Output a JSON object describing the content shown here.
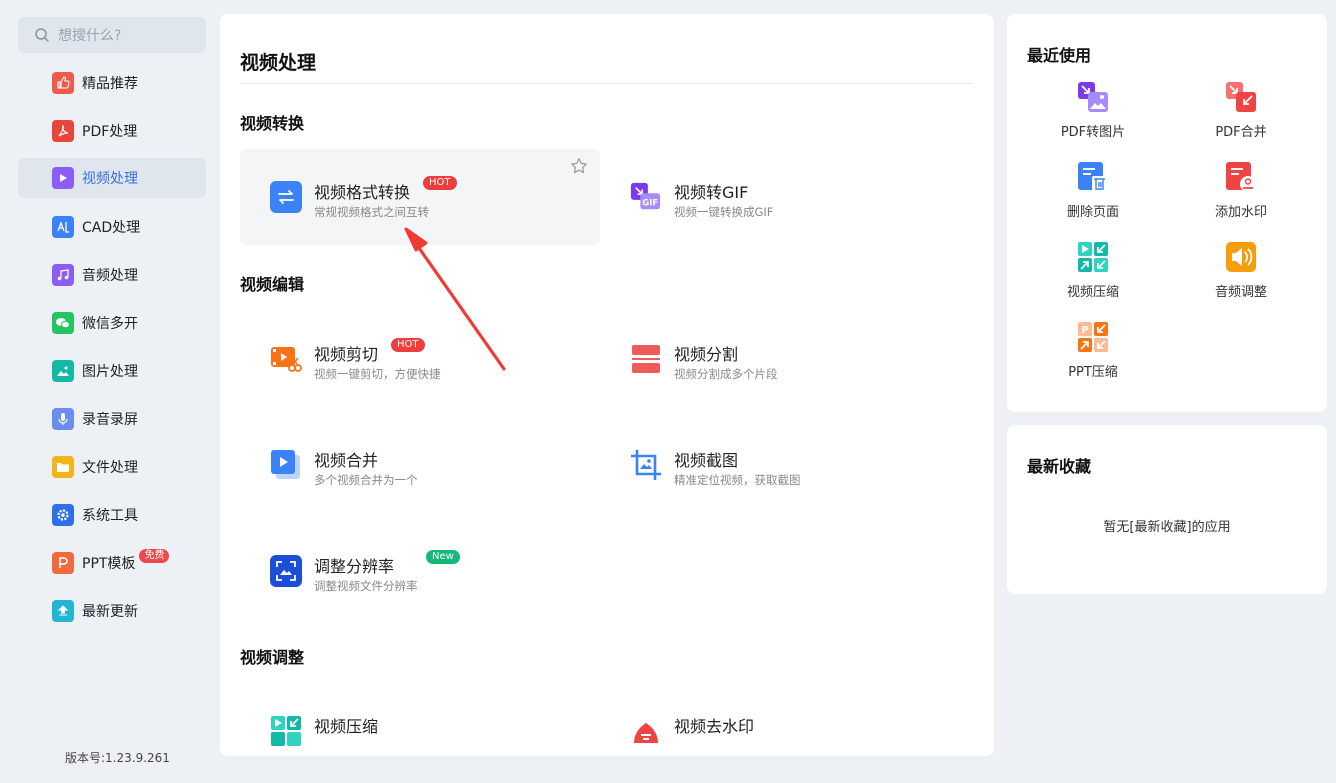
{
  "search": {
    "placeholder": "想搜什么?"
  },
  "sidebar": {
    "items": [
      {
        "label": "精品推荐",
        "icon": "thumbs-up-icon",
        "color": "#f05a4a"
      },
      {
        "label": "PDF处理",
        "icon": "pdf-icon",
        "color": "#e8453c"
      },
      {
        "label": "视频处理",
        "icon": "play-icon",
        "color": "#8b5cf6",
        "active": true
      },
      {
        "label": "CAD处理",
        "icon": "cad-icon",
        "color": "#3b82f6"
      },
      {
        "label": "音频处理",
        "icon": "music-icon",
        "color": "#8b5cf6"
      },
      {
        "label": "微信多开",
        "icon": "wechat-icon",
        "color": "#22c55e"
      },
      {
        "label": "图片处理",
        "icon": "image-icon",
        "color": "#14b8a6"
      },
      {
        "label": "录音录屏",
        "icon": "microphone-icon",
        "color": "#6b8cf0"
      },
      {
        "label": "文件处理",
        "icon": "folder-icon",
        "color": "#f5b31a"
      },
      {
        "label": "系统工具",
        "icon": "gear-icon",
        "color": "#2f6fe8"
      },
      {
        "label": "PPT模板",
        "icon": "ppt-icon",
        "color": "#f06a3c",
        "badge": "免费"
      },
      {
        "label": "最新更新",
        "icon": "upload-icon",
        "color": "#22b5d4"
      }
    ]
  },
  "version": "版本号:1.23.9.261",
  "main": {
    "title": "视频处理",
    "sections": [
      {
        "title": "视频转换",
        "tools": [
          {
            "name": "视频格式转换",
            "desc": "常规视频格式之间互转",
            "badge": "HOT",
            "icon": "swap-arrows-icon"
          },
          {
            "name": "视频转GIF",
            "desc": "视频一键转换成GIF",
            "icon": "gif-icon"
          }
        ]
      },
      {
        "title": "视频编辑",
        "tools": [
          {
            "name": "视频剪切",
            "desc": "视频一键剪切，方便快捷",
            "badge": "HOT",
            "icon": "video-cut-icon"
          },
          {
            "name": "视频分割",
            "desc": "视频分割成多个片段",
            "icon": "split-icon"
          },
          {
            "name": "视频合并",
            "desc": "多个视频合并为一个",
            "icon": "video-merge-icon"
          },
          {
            "name": "视频截图",
            "desc": "精准定位视频，获取截图",
            "icon": "crop-icon"
          },
          {
            "name": "调整分辨率",
            "desc": "调整视频文件分辨率",
            "badge": "New",
            "icon": "resolution-icon"
          }
        ]
      },
      {
        "title": "视频调整",
        "tools": [
          {
            "name": "视频压缩",
            "icon": "compress-icon"
          },
          {
            "name": "视频去水印",
            "icon": "remove-watermark-icon"
          }
        ]
      }
    ]
  },
  "recent": {
    "title": "最近使用",
    "items": [
      {
        "label": "PDF转图片",
        "icon": "pdf-to-image-icon"
      },
      {
        "label": "PDF合并",
        "icon": "pdf-merge-icon"
      },
      {
        "label": "删除页面",
        "icon": "delete-page-icon"
      },
      {
        "label": "添加水印",
        "icon": "add-watermark-icon"
      },
      {
        "label": "视频压缩",
        "icon": "video-compress-icon"
      },
      {
        "label": "音频调整",
        "icon": "audio-adjust-icon"
      },
      {
        "label": "PPT压缩",
        "icon": "ppt-compress-icon"
      }
    ]
  },
  "favorites": {
    "title": "最新收藏",
    "empty_text": "暂无[最新收藏]的应用"
  }
}
